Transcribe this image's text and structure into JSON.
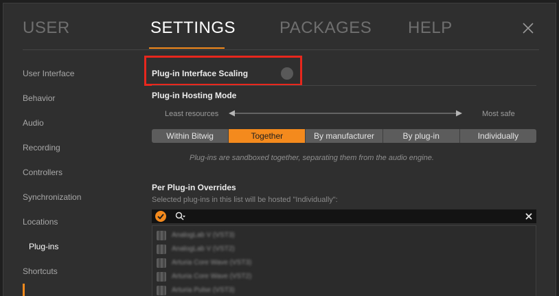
{
  "tabs": [
    "USER",
    "SETTINGS",
    "PACKAGES",
    "HELP"
  ],
  "active_tab": "SETTINGS",
  "sidebar": {
    "items": [
      "User Interface",
      "Behavior",
      "Audio",
      "Recording",
      "Controllers",
      "Synchronization",
      "Locations",
      "Plug-ins",
      "Shortcuts"
    ],
    "active": "Plug-ins"
  },
  "plugins": {
    "interface_scaling_label": "Plug-in Interface Scaling",
    "hosting_mode_label": "Plug-in Hosting Mode",
    "least_resources": "Least resources",
    "most_safe": "Most safe",
    "modes": [
      "Within Bitwig",
      "Together",
      "By manufacturer",
      "By plug-in",
      "Individually"
    ],
    "selected_mode": "Together",
    "mode_hint": "Plug-ins are sandboxed together, separating them from the audio engine.",
    "overrides_title": "Per Plug-in Overrides",
    "overrides_subtitle": "Selected plug-ins in this list will be hosted \"Individually\":",
    "list_items": [
      "AnalogLab V (VST3)",
      "AnalogLab V (VST2)",
      "Arturia Core Wave (VST3)",
      "Arturia Core Wave (VST2)",
      "Arturia Pulse (VST3)"
    ]
  },
  "colors": {
    "accent": "#f48a1d",
    "highlight_box": "#e8271d"
  },
  "icons": {
    "close": "close-icon",
    "check": "check-icon",
    "search": "search-icon",
    "clear": "clear-icon"
  }
}
